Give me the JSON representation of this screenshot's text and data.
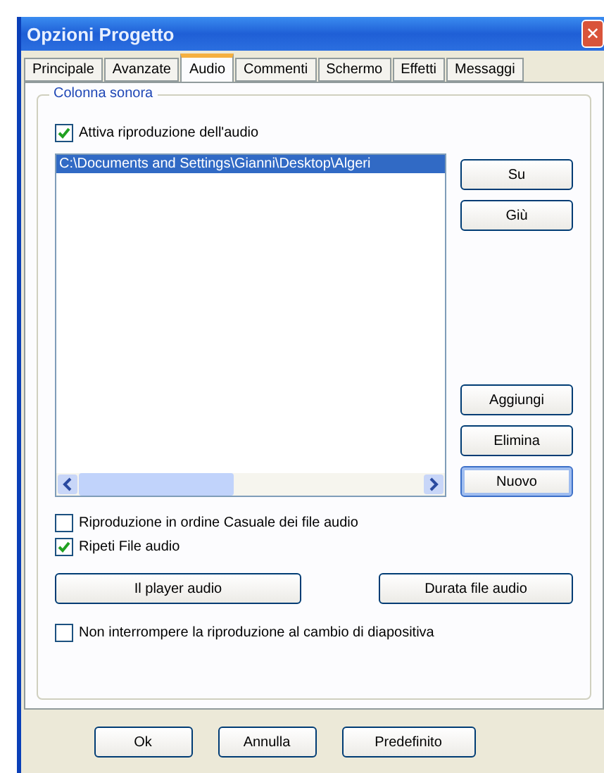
{
  "window": {
    "title": "Opzioni Progetto",
    "close": "✕"
  },
  "tabs": [
    {
      "label": "Principale",
      "selected": false
    },
    {
      "label": "Avanzate",
      "selected": false
    },
    {
      "label": "Audio",
      "selected": true
    },
    {
      "label": "Commenti",
      "selected": false
    },
    {
      "label": "Schermo",
      "selected": false
    },
    {
      "label": "Effetti",
      "selected": false
    },
    {
      "label": "Messaggi",
      "selected": false
    }
  ],
  "group": {
    "title": "Colonna sonora"
  },
  "enable_audio": {
    "label": "Attiva riproduzione dell'audio",
    "checked": true
  },
  "file_list": {
    "items": [
      {
        "text": "C:\\Documents and Settings\\Gianni\\Desktop\\Algeri",
        "selected": true
      }
    ]
  },
  "move_buttons": [
    {
      "label": "Su",
      "focused": false
    },
    {
      "label": "Giù",
      "focused": false
    }
  ],
  "edit_buttons": [
    {
      "label": "Aggiungi",
      "focused": false
    },
    {
      "label": "Elimina",
      "focused": false
    },
    {
      "label": "Nuovo",
      "focused": true
    }
  ],
  "options": [
    {
      "label": "Riproduzione in ordine Casuale dei file audio",
      "checked": false
    },
    {
      "label": "Ripeti File audio",
      "checked": true
    }
  ],
  "action_buttons": [
    {
      "label": "Il player audio"
    },
    {
      "label": "Durata file audio"
    }
  ],
  "keep_playing": {
    "label": "Non interrompere la riproduzione al cambio di diapositiva",
    "checked": false
  },
  "dialog_buttons": [
    {
      "label": "Ok"
    },
    {
      "label": "Annulla"
    },
    {
      "label": "Predefinito"
    }
  ]
}
